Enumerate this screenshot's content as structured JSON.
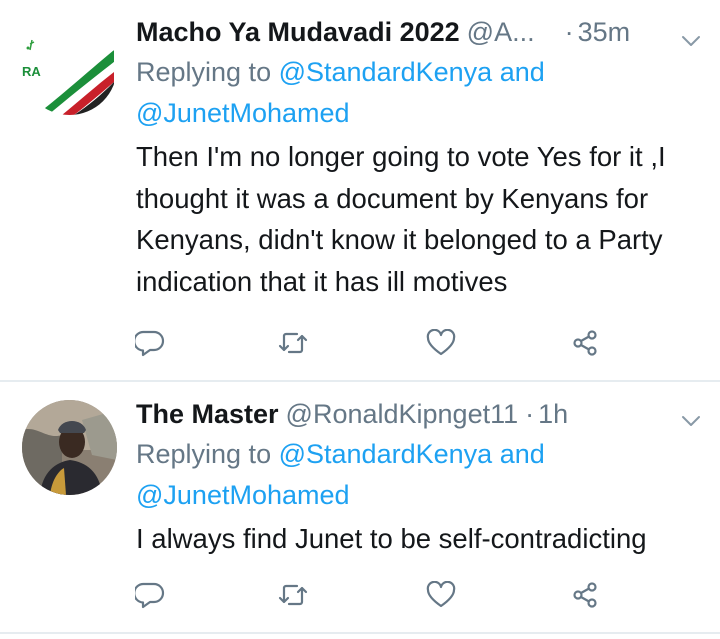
{
  "colors": {
    "text": "#14171a",
    "muted": "#657786",
    "link": "#1da1f2",
    "divider": "#e6ecf0"
  },
  "tweets": [
    {
      "display_name": "Macho Ya Mudavadi 2022",
      "handle": "@A...",
      "dot": "·",
      "time": "35m",
      "replying_to_prefix": "Replying to",
      "mention_1": "@StandardKenya",
      "and_word": "and",
      "mention_2": "@JunetMohamed",
      "text": "Then I'm no longer going to vote Yes for it ,I thought it was a document by Kenyans for Kenyans, didn't know it belonged to a Party indication that it has ill motives",
      "avatar_logo_text": "RA",
      "icons": [
        "reply-icon",
        "retweet-icon",
        "like-icon",
        "share-icon"
      ]
    },
    {
      "display_name": "The Master",
      "handle": "@RonaldKipnget11",
      "dot": "·",
      "time": "1h",
      "replying_to_prefix": "Replying to",
      "mention_1": "@StandardKenya",
      "and_word": "and",
      "mention_2": "@JunetMohamed",
      "text": "I always find Junet to be self-contradicting",
      "icons": [
        "reply-icon",
        "retweet-icon",
        "like-icon",
        "share-icon"
      ]
    }
  ]
}
